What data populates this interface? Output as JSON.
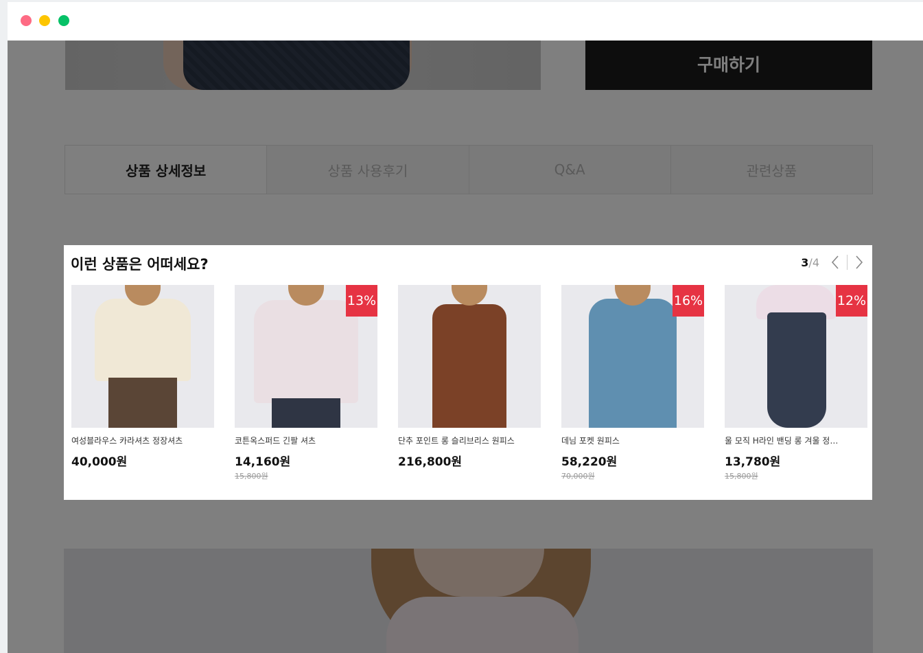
{
  "window": {
    "controls": [
      "close",
      "minimize",
      "maximize"
    ],
    "colors": {
      "close": "#fe6b84",
      "minimize": "#fdc500",
      "maximize": "#06c167"
    }
  },
  "page": {
    "buy_button_label": "구매하기",
    "tabs": [
      {
        "label": "상품 상세정보",
        "active": true
      },
      {
        "label": "상품 사용후기",
        "active": false
      },
      {
        "label": "Q&A",
        "active": false
      },
      {
        "label": "관련상품",
        "active": false
      }
    ]
  },
  "recommendations": {
    "title": "이런 상품은 어떠세요?",
    "pager": {
      "current": "3",
      "total": "/4"
    },
    "accent_color": "#e63343",
    "products": [
      {
        "name": "여성블라우스 카라셔츠 정장셔츠",
        "price": "40,000원",
        "original_price": "",
        "discount": ""
      },
      {
        "name": "코튼옥스퍼드 긴팔 셔츠",
        "price": "14,160원",
        "original_price": "15,800원",
        "discount": "13%"
      },
      {
        "name": "단추 포인트 롱 슬리브리스 원피스",
        "price": "216,800원",
        "original_price": "",
        "discount": ""
      },
      {
        "name": "데님 포켓 원피스",
        "price": "58,220원",
        "original_price": "70,000원",
        "discount": "16%"
      },
      {
        "name": "울 모직 H라인 밴딩 롱 겨울 정…",
        "price": "13,780원",
        "original_price": "15,800원",
        "discount": "12%"
      }
    ]
  }
}
